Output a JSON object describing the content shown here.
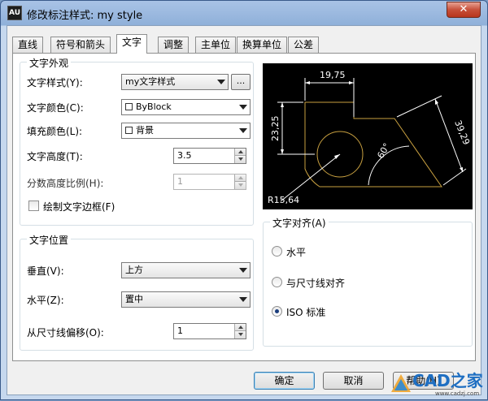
{
  "window": {
    "icon_text": "AU",
    "title": "修改标注样式: my style",
    "close_label": "✕"
  },
  "tabs": [
    {
      "label": "直线"
    },
    {
      "label": "符号和箭头"
    },
    {
      "label": "文字"
    },
    {
      "label": "调整"
    },
    {
      "label": "主单位"
    },
    {
      "label": "换算单位"
    },
    {
      "label": "公差"
    }
  ],
  "appearance": {
    "title": "文字外观",
    "style_label": "文字样式(Y):",
    "style_value": "my文字样式",
    "style_browse": "...",
    "color_label": "文字颜色(C):",
    "color_value": "ByBlock",
    "fill_label": "填充颜色(L):",
    "fill_value": "背景",
    "height_label": "文字高度(T):",
    "height_value": "3.5",
    "fraction_label": "分数高度比例(H):",
    "fraction_value": "1",
    "frame_label": "绘制文字边框(F)",
    "frame_checked": false
  },
  "placement": {
    "title": "文字位置",
    "vertical_label": "垂直(V):",
    "vertical_value": "上方",
    "horizontal_label": "水平(Z):",
    "horizontal_value": "置中",
    "offset_label": "从尺寸线偏移(O):",
    "offset_value": "1"
  },
  "alignment": {
    "title": "文字对齐(A)",
    "options": [
      {
        "label": "水平",
        "checked": false
      },
      {
        "label": "与尺寸线对齐",
        "checked": false
      },
      {
        "label": "ISO 标准",
        "checked": true
      }
    ]
  },
  "preview": {
    "dim_top": "19,75",
    "dim_left": "23,25",
    "dim_right": "39,29",
    "dim_angle": "60°",
    "dim_radius": "R15,64",
    "colors": {
      "background": "#000000",
      "geometry": "#c8a040",
      "dimension": "#ffffff"
    }
  },
  "buttons": {
    "ok": "确定",
    "cancel": "取消",
    "help": "帮助(H)"
  },
  "watermark": {
    "text": "CAD之家",
    "url": "www.cadzj.com"
  }
}
